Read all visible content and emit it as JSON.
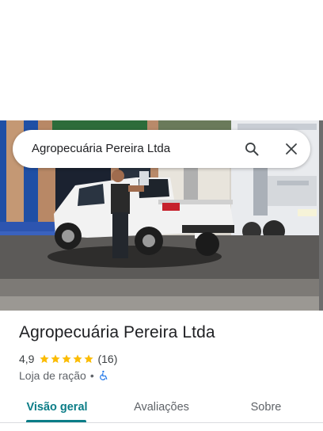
{
  "search": {
    "query": "Agropecuária Pereira Ltda",
    "search_icon": "search-icon",
    "close_icon": "close-icon"
  },
  "place": {
    "name": "Agropecuária Pereira Ltda",
    "rating": "4,9",
    "rating_value": 4.9,
    "stars_max": 5,
    "review_count": "(16)",
    "category": "Loja de ração",
    "separator": "•",
    "accessibility_icon": "wheelchair-icon"
  },
  "tabs": [
    {
      "label": "Visão geral",
      "active": true
    },
    {
      "label": "Avaliações",
      "active": false
    },
    {
      "label": "Sobre",
      "active": false
    }
  ],
  "colors": {
    "accent": "#0b7d87",
    "star": "#fbbc04",
    "text_primary": "#202124",
    "text_secondary": "#5f6368",
    "accessibility": "#1a73e8"
  }
}
